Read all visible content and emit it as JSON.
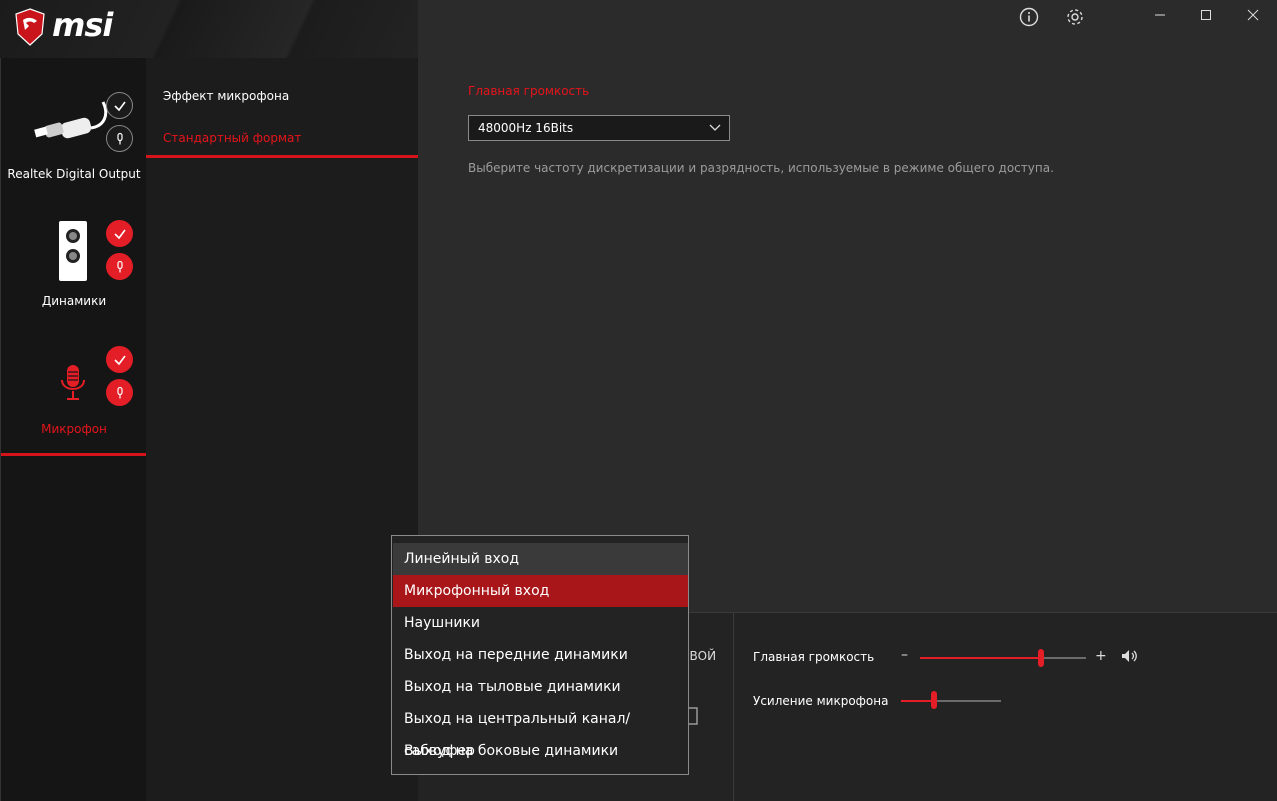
{
  "app": {
    "brand": "msi",
    "title_icons": [
      "info-icon",
      "settings-gear-icon"
    ],
    "window_controls": [
      "minimize",
      "maximize",
      "close"
    ]
  },
  "devices": [
    {
      "label": "Realtek Digital Output",
      "icon": "optical-cable-icon",
      "active": false,
      "status_badges": [
        "check",
        "mic"
      ]
    },
    {
      "label": "Динамики",
      "icon": "speaker-jacks-icon",
      "active": false,
      "status_badges": [
        "check",
        "mic"
      ]
    },
    {
      "label": "Микрофон",
      "icon": "microphone-icon",
      "active": true,
      "status_badges": [
        "check",
        "mic"
      ]
    }
  ],
  "submenu": {
    "items": [
      {
        "label": "Эффект микрофона",
        "active": false
      },
      {
        "label": "Стандартный формат",
        "active": true
      }
    ]
  },
  "main": {
    "section_title": "Главная громкость",
    "format_select": {
      "value": "48000Hz 16Bits"
    },
    "description": "Выберите частоту дискретизации и разрядность, используемые в режиме общего доступа."
  },
  "bottom": {
    "partial_text": "ОВОЙ",
    "master_volume_label": "Главная громкость",
    "master_volume_level": 0.73,
    "mic_boost_label": "Усиление микрофона",
    "mic_boost_level": 0.33
  },
  "dropdown": {
    "items": [
      {
        "label": "Линейный вход",
        "state": "hover"
      },
      {
        "label": "Микрофонный вход",
        "state": "selected"
      },
      {
        "label": "Наушники",
        "state": ""
      },
      {
        "label": "Выход на передние динамики",
        "state": ""
      },
      {
        "label": "Выход на тыловые динамики",
        "state": ""
      },
      {
        "label": "Выход на центральный канал/сабвуфер",
        "state": ""
      },
      {
        "label": "Выход на боковые динамики",
        "state": ""
      }
    ]
  },
  "colors": {
    "accent": "#e41e26",
    "selected": "#a91619",
    "background": "#2b2b2b"
  }
}
